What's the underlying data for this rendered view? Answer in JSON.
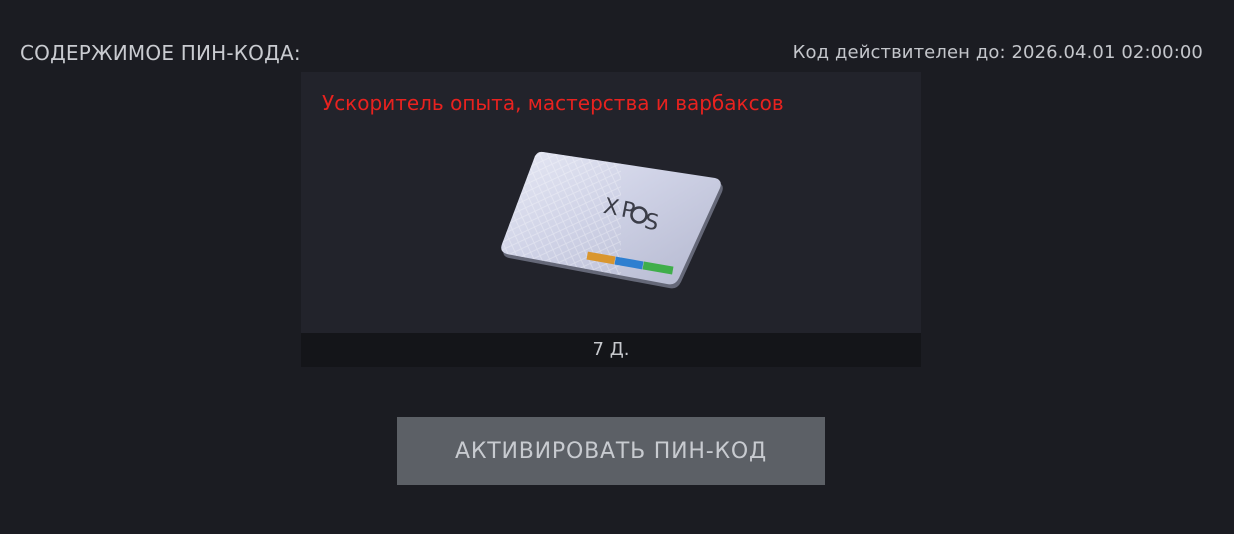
{
  "header": {
    "title": "СОДЕРЖИМОЕ ПИН-КОДА:",
    "expiry": "Код действителен до: 2026.04.01 02:00:00"
  },
  "item": {
    "name": "Ускоритель опыта, мастерства и варбаксов",
    "duration": "7 Д.",
    "card_logo": "XPOS",
    "name_color": "#e8221f",
    "stripe_colors": [
      "#d9962e",
      "#2e7fd0",
      "#3fae4a"
    ]
  },
  "actions": {
    "activate_label": "АКТИВИРОВАТЬ ПИН-КОД"
  }
}
